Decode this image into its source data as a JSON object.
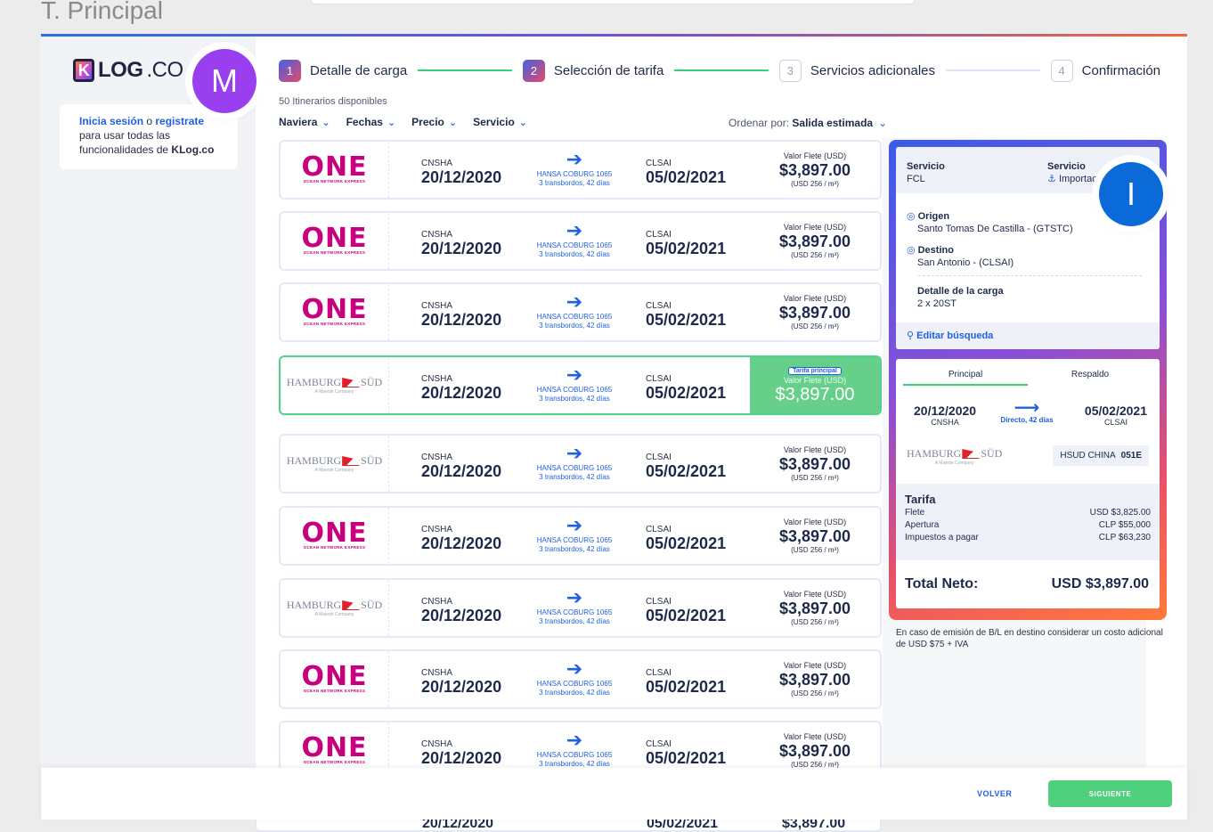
{
  "frame_title": "T. Principal",
  "logo": {
    "k": "K",
    "text": "LOG",
    "co": ".CO"
  },
  "login": {
    "link1": "Inicia sesión",
    "o": " o ",
    "link2": "registrate",
    "rest": " para usar todas las funcionalidades de ",
    "brand": "KLog.co"
  },
  "avatars": {
    "m": "M",
    "i": "I"
  },
  "steps": [
    {
      "num": "1",
      "label": "Detalle de carga"
    },
    {
      "num": "2",
      "label": "Selección de tarifa"
    },
    {
      "num": "3",
      "label": "Servicios adicionales"
    },
    {
      "num": "4",
      "label": "Confirmación"
    }
  ],
  "itin_count": "50 Itinerarios disponibles",
  "filters": [
    "Naviera",
    "Fechas",
    "Precio",
    "Servicio"
  ],
  "sort": {
    "label": "Ordenar por:",
    "value": "Salida estimada"
  },
  "results": [
    {
      "carrier": "ONE",
      "origin": "CNSHA",
      "dep": "20/12/2020",
      "vessel": "HANSA COBURG 1065",
      "via": "3 transbordos, 42 días",
      "dest": "CLSAI",
      "arr": "05/02/2021",
      "price_label": "Valor Flete (USD)",
      "price": "$3,897.00",
      "unit": "(USD 256 / m³)"
    },
    {
      "carrier": "ONE",
      "origin": "CNSHA",
      "dep": "20/12/2020",
      "vessel": "HANSA COBURG 1065",
      "via": "3 transbordos, 42 días",
      "dest": "CLSAI",
      "arr": "05/02/2021",
      "price_label": "Valor Flete (USD)",
      "price": "$3,897.00",
      "unit": "(USD 256 / m³)"
    },
    {
      "carrier": "ONE",
      "origin": "CNSHA",
      "dep": "20/12/2020",
      "vessel": "HANSA COBURG 1065",
      "via": "3 transbordos, 42 días",
      "dest": "CLSAI",
      "arr": "05/02/2021",
      "price_label": "Valor Flete (USD)",
      "price": "$3,897.00",
      "unit": "(USD 256 / m³)"
    },
    {
      "carrier": "HAMBURG SÜD",
      "origin": "CNSHA",
      "dep": "20/12/2020",
      "vessel": "HANSA COBURG 1065",
      "via": "3 transbordos, 42 días",
      "dest": "CLSAI",
      "arr": "05/02/2021",
      "tag": "Tarifa principal",
      "price_label": "Valor Flete (USD)",
      "price": "$3,897.00",
      "unit": ""
    },
    {
      "carrier": "HAMBURG SÜD",
      "origin": "CNSHA",
      "dep": "20/12/2020",
      "vessel": "HANSA COBURG 1065",
      "via": "3 transbordos, 42 días",
      "dest": "CLSAI",
      "arr": "05/02/2021",
      "price_label": "Valor Flete (USD)",
      "price": "$3,897.00",
      "unit": "(USD 256 / m³)"
    },
    {
      "carrier": "ONE",
      "origin": "CNSHA",
      "dep": "20/12/2020",
      "vessel": "HANSA COBURG 1065",
      "via": "3 transbordos, 42 días",
      "dest": "CLSAI",
      "arr": "05/02/2021",
      "price_label": "Valor Flete (USD)",
      "price": "$3,897.00",
      "unit": "(USD 256 / m³)"
    },
    {
      "carrier": "HAMBURG SÜD",
      "origin": "CNSHA",
      "dep": "20/12/2020",
      "vessel": "HANSA COBURG 1065",
      "via": "3 transbordos, 42 días",
      "dest": "CLSAI",
      "arr": "05/02/2021",
      "price_label": "Valor Flete (USD)",
      "price": "$3,897.00",
      "unit": "(USD 256 / m³)"
    },
    {
      "carrier": "ONE",
      "origin": "CNSHA",
      "dep": "20/12/2020",
      "vessel": "HANSA COBURG 1065",
      "via": "3 transbordos, 42 días",
      "dest": "CLSAI",
      "arr": "05/02/2021",
      "price_label": "Valor Flete (USD)",
      "price": "$3,897.00",
      "unit": "(USD 256 / m³)"
    },
    {
      "carrier": "ONE",
      "origin": "CNSHA",
      "dep": "20/12/2020",
      "vessel": "HANSA COBURG 1065",
      "via": "3 transbordos, 42 días",
      "dest": "CLSAI",
      "arr": "05/02/2021",
      "price_label": "Valor Flete (USD)",
      "price": "$3,897.00",
      "unit": "(USD 256 / m³)"
    }
  ],
  "one_sub": "OCEAN NETWORK EXPRESS",
  "hs_sub": "A Maersk Company",
  "summary": {
    "servicio_label": "Servicio",
    "servicio_value": "FCL",
    "servicio2_label": "Servicio",
    "servicio2_value": "Importación",
    "origen_label": "Origen",
    "origen_value": "Santo Tomas De Castilla - (GTSTC)",
    "destino_label": "Destino",
    "destino_value": "San Antonio - (CLSAI)",
    "detalle_label": "Detalle de la carga",
    "detalle_value": "2 x 20ST",
    "edit": "Editar búsqueda",
    "tab_principal": "Principal",
    "tab_respaldo": "Respaldo",
    "dep": "20/12/2020",
    "dep_code": "CNSHA",
    "direct": "Directo, 42 días",
    "arr": "05/02/2021",
    "arr_code": "CLSAI",
    "vessel": "HSUD CHINA",
    "voyage": "051E",
    "tarifa_title": "Tarifa",
    "lines": [
      {
        "label": "Flete",
        "value": "USD $3,825.00"
      },
      {
        "label": "Apertura",
        "value": "CLP $55,000"
      },
      {
        "label": "Impuestos a pagar",
        "value": "CLP $63,230"
      }
    ],
    "neto_label": "Total Neto:",
    "neto_value": "USD $3,897.00"
  },
  "note": "En caso de emisión de B/L en destino considerar un costo adicional de USD $75 + IVA",
  "footer": {
    "volver": "VOLVER",
    "siguiente": "SIGUIENTE"
  },
  "peek": {
    "dep": "20/12/2020",
    "arr": "05/02/2021",
    "price": "$3,897.00"
  },
  "colors": {
    "accent": "#1f5fe0",
    "success": "#4fd07d",
    "one_brand": "#c8007f"
  }
}
